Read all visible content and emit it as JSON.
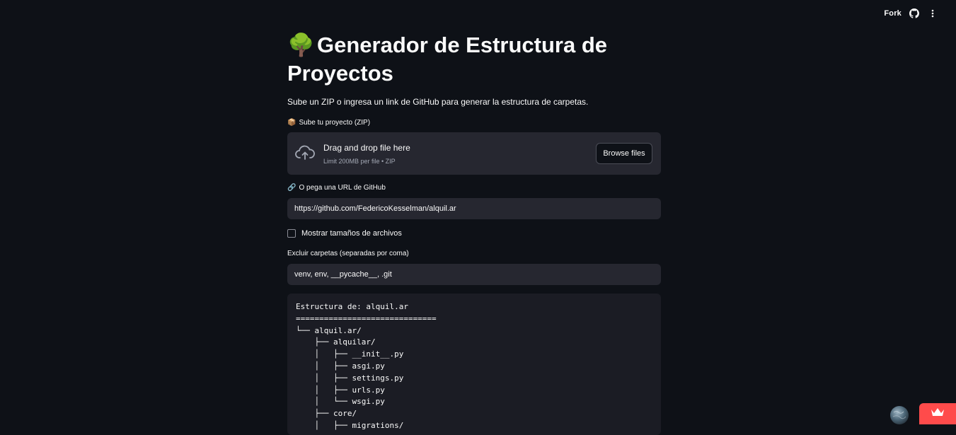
{
  "topbar": {
    "fork_label": "Fork",
    "github_icon": "github-icon",
    "menu_icon": "more-vertical-icon"
  },
  "header": {
    "emoji": "🌳",
    "title": "Generador de Estructura de Proyectos"
  },
  "subtitle": "Sube un ZIP o ingresa un link de GitHub para generar la estructura de carpetas.",
  "uploader": {
    "label_icon": "📦",
    "label": "Sube tu proyecto (ZIP)",
    "drop_text": "Drag and drop file here",
    "limit_text": "Limit 200MB per file • ZIP",
    "browse_label": "Browse files"
  },
  "github_url": {
    "label_icon": "🔗",
    "label": "O pega una URL de GitHub",
    "value": "https://github.com/FedericoKesselman/alquil.ar"
  },
  "show_sizes": {
    "label": "Mostrar tamaños de archivos",
    "checked": false
  },
  "exclude": {
    "label": "Excluir carpetas (separadas por coma)",
    "value": "venv, env, __pycache__, .git"
  },
  "structure_output": "Estructura de: alquil.ar\n==============================\n└── alquil.ar/\n    ├── alquilar/\n    │   ├── __init__.py\n    │   ├── asgi.py\n    │   ├── settings.py\n    │   ├── urls.py\n    │   └── wsgi.py\n    ├── core/\n    │   ├── migrations/",
  "colors": {
    "background": "#0e1117",
    "input_bg": "#262730",
    "code_bg": "#1b1c24",
    "accent": "#ff4b4b",
    "text": "#fafafa"
  }
}
